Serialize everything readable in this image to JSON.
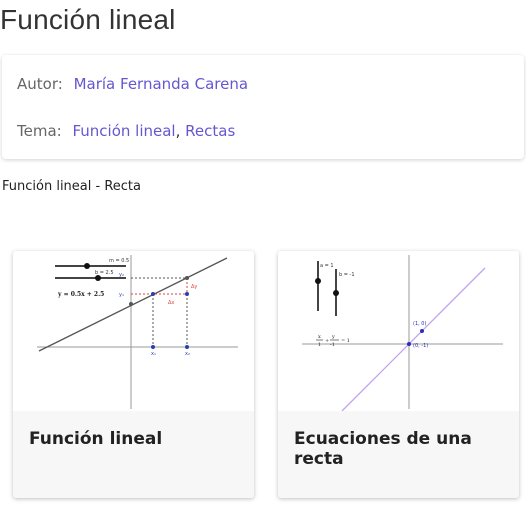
{
  "page": {
    "title": "Función lineal"
  },
  "info": {
    "author_label": "Autor:",
    "author_name": "María Fernanda Carena",
    "topic_label": "Tema:",
    "topic_1": "Función lineal",
    "topic_sep": ",",
    "topic_2": "Rectas"
  },
  "description": "Función lineal - Recta",
  "cards": [
    {
      "title": "Función lineal",
      "thumb": {
        "slider_m": "m = 0.5",
        "slider_b": "b = 2.5",
        "equation": "y = 0.5x + 2.5",
        "label_y1": "y₁",
        "label_y2": "y₂",
        "label_x1": "x₁",
        "label_x2": "x₂",
        "label_dy": "Δy",
        "label_dx": "Δx",
        "color_line": "#555555",
        "color_red": "#e04040",
        "color_blue": "#2a3fb5"
      }
    },
    {
      "title": "Ecuaciones de una recta",
      "thumb": {
        "slider_a": "a = 1",
        "slider_b": "b = -1",
        "equation_num_x": "x",
        "equation_den_x": "1",
        "equation_num_y": "y",
        "equation_den_y": "-1",
        "equation_rhs": "= 1",
        "point_a": "(1, 0)",
        "point_b": "(0, -1)",
        "color_line": "#c2a3f0",
        "color_point": "#2a2fb5"
      }
    }
  ]
}
